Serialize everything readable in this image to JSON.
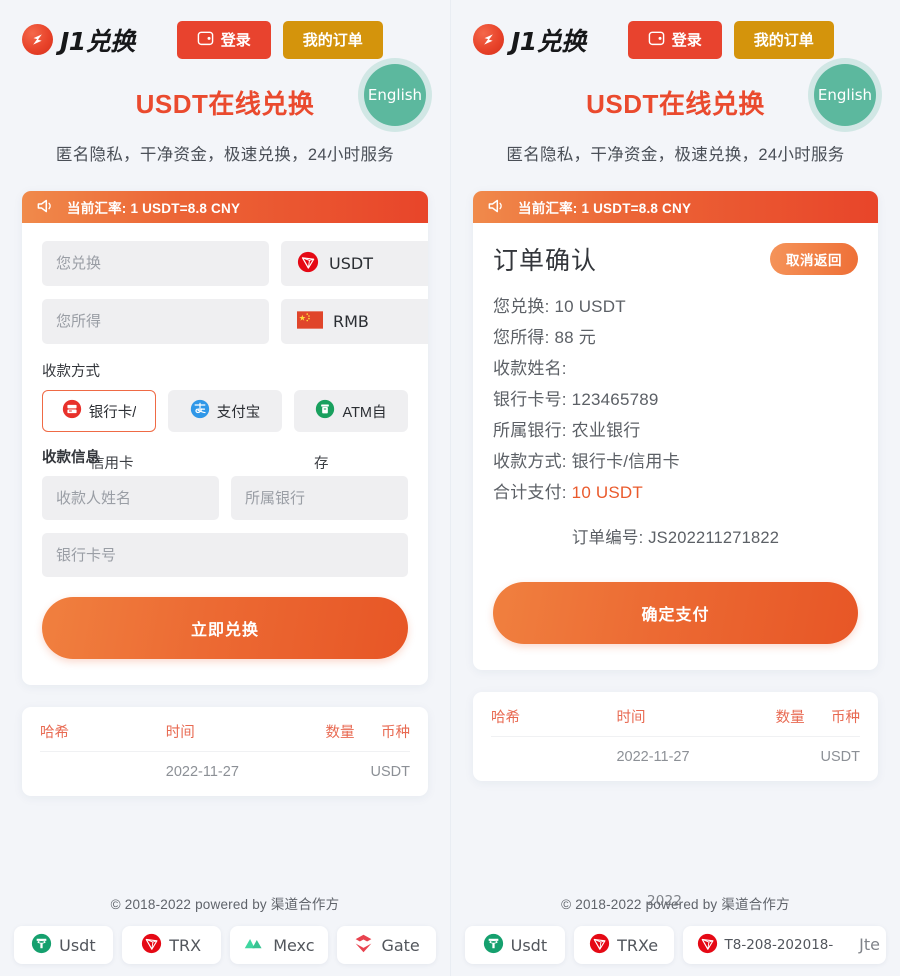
{
  "brand": {
    "logo_text": "J1兑换",
    "logo_icon": "lightning-circle-logo"
  },
  "nav": {
    "login_label": "登录",
    "login_icon": "wallet-icon",
    "orders_label": "我的订单"
  },
  "hero": {
    "title": "USDT在线兑换",
    "subtitle": "匿名隐私，干净资金，极速兑换，24小时服务",
    "lang_badge": "English"
  },
  "rate_banner": {
    "icon": "megaphone-icon",
    "text": "当前汇率: 1 USDT=8.8 CNY"
  },
  "exchange_form": {
    "pay_placeholder": "您兑换",
    "pay_value": "",
    "pay_coin": "USDT",
    "pay_coin_icon": "tron-usdt-icon",
    "receive_placeholder": "您所得",
    "receive_value": "",
    "receive_coin": "RMB",
    "receive_coin_icon": "china-flag-icon",
    "method_label": "收款方式",
    "methods": [
      {
        "label": "银行卡/",
        "label_overflow": "信用卡",
        "icon": "bank-card-icon",
        "selected": true
      },
      {
        "label": "支付宝",
        "label_overflow": "",
        "icon": "alipay-icon",
        "selected": false
      },
      {
        "label": "ATM自",
        "label_overflow": "存",
        "icon": "atm-icon",
        "selected": false
      }
    ],
    "payee_label": "收款信息",
    "payee_name_placeholder": "收款人姓名",
    "payee_name_value": "",
    "bank_placeholder": "所属银行",
    "bank_value": "",
    "card_placeholder": "银行卡号",
    "card_value": "",
    "submit_label": "立即兑换"
  },
  "order_confirm": {
    "title": "订单确认",
    "cancel_label": "取消返回",
    "lines": [
      {
        "label": "您兑换:",
        "value": "10 USDT",
        "highlight": false
      },
      {
        "label": "您所得:",
        "value": "88 元",
        "highlight": false
      },
      {
        "label": "收款姓名:",
        "value": "",
        "highlight": false
      },
      {
        "label": "银行卡号:",
        "value": "123465789",
        "highlight": false
      },
      {
        "label": "所属银行:",
        "value": "农业银行",
        "highlight": false
      },
      {
        "label": "收款方式:",
        "value": "银行卡/信用卡",
        "highlight": false
      },
      {
        "label": "合计支付:",
        "value": "10 USDT",
        "highlight": true
      }
    ],
    "order_no_label": "订单编号:",
    "order_no": "JS202211271822",
    "confirm_label": "确定支付"
  },
  "hash_table": {
    "headers": [
      "哈希",
      "时间",
      "数量",
      "币种"
    ],
    "rows": [
      {
        "hash": "",
        "time": "2022-11-27",
        "amount": "",
        "coin": "USDT"
      }
    ]
  },
  "footer_left": {
    "copyright": "© 2018-2022 powered by 渠道合作方",
    "partners": [
      {
        "name": "Usdt",
        "icon": "tether-icon"
      },
      {
        "name": "TRX",
        "icon": "tron-icon"
      },
      {
        "name": "Mexc",
        "icon": "mexc-icon"
      },
      {
        "name": "Gate",
        "icon": "gate-icon"
      }
    ]
  },
  "footer_right": {
    "copyright": "© 2018-2022 powered by 渠道合作方",
    "copyright_ghost": "2022",
    "partners": [
      {
        "name": "Usdt",
        "icon": "tether-icon"
      },
      {
        "name": "TRXe",
        "icon": "tron-icon"
      },
      {
        "name": "T8-208-202018-",
        "icon": "tron-icon"
      }
    ],
    "ghost_text": "Jte"
  },
  "colors": {
    "page_bg": "#f3f5f9",
    "brand_red": "#e8432e",
    "brand_orange": "#ea4a2e",
    "amber": "#d4940c",
    "teal": "#5cb89e",
    "field_bg": "#efeff1"
  }
}
